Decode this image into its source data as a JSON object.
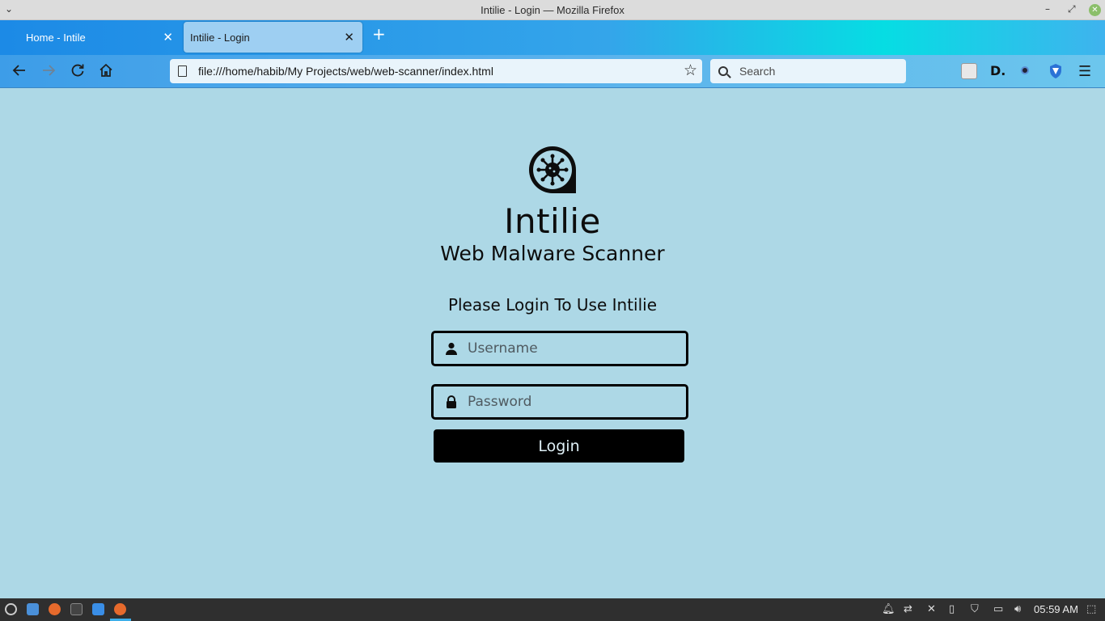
{
  "window": {
    "title": "Intilie - Login — Mozilla Firefox"
  },
  "tabs": [
    {
      "label": "Home - Intile",
      "active": false
    },
    {
      "label": "Intilie - Login",
      "active": true
    }
  ],
  "navbar": {
    "url": "file:///home/habib/My Projects/web/web-scanner/index.html",
    "search_placeholder": "Search"
  },
  "page": {
    "brand": "Intilie",
    "subtitle": "Web Malware Scanner",
    "prompt": "Please Login To Use Intilie",
    "username_placeholder": "Username",
    "password_placeholder": "Password",
    "login_label": "Login",
    "background_color": "#add8e6"
  },
  "taskbar": {
    "clock": "05:59 AM"
  },
  "icons": {
    "back": "arrow-left-icon",
    "forward": "arrow-right-icon",
    "reload": "reload-icon",
    "home": "home-icon",
    "bookmark": "star-icon",
    "search": "magnifier-icon",
    "user": "user-icon",
    "lock": "lock-icon",
    "logo": "virus-chat-logo-icon"
  }
}
